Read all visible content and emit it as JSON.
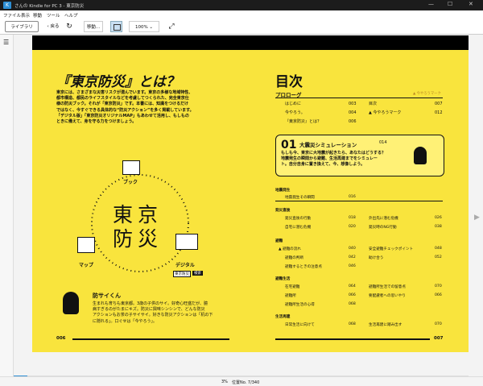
{
  "window": {
    "title": "さんの Kindle for PC 3 - 東京防災"
  },
  "menu": [
    "ファイル",
    "表示",
    "移動",
    "ツール",
    "ヘルプ"
  ],
  "toolbar": {
    "library": "ライブラリ",
    "back": "戻る",
    "goto": "移動...",
    "zoom": "100%"
  },
  "status": {
    "progress": "3%",
    "location": "位置No. 7/340"
  },
  "left": {
    "title": "『東京防災』とは？",
    "intro": [
      "東京には、さまざまな災害リスクが潜んでいます。東京の多様な地域特性、",
      "都市構造、都民のライフスタイルなどを考慮してつくられた、完全東京仕",
      "様の防災ブック。それが「東京防災」です。本書には、知識をつけるだけ",
      "ではなく、今すぐできる具体的な“防災アクション”を多く掲載しています。",
      "「デジタル版」「東京防災オリジナルMAP」もあわせて活用し、もしもの",
      "ときに備えて、身を守る力をつけましょう。"
    ],
    "center1": "東京",
    "center2": "防災",
    "book_label": "ブック",
    "map_label": "マップ",
    "digital_label": "デジタル",
    "tag1": "東京防災",
    "tag2": "検索",
    "mascot_title": "防サイくん",
    "mascot_text": [
      "生まれも育ちも東京都。3歳の子供のサイ。好奇心旺盛だが、臆",
      "病すぎるのがたまにキズ。防災に興味シンシンで、どんな防災",
      "アクションもお茶の子サイサイ。好きな防災アクションは「机の下",
      "に隠れる」。口ぐせは「今やろう」。"
    ],
    "page_no": "006"
  },
  "right": {
    "title": "目次",
    "prologue": "プロローグ",
    "mark_legend": "▲ 今やろうマーク",
    "prologue_items": [
      [
        "はじめに",
        "003"
      ],
      [
        "今やろう。",
        "004"
      ],
      [
        "『東京防災』とは？",
        "006"
      ],
      [
        "目次",
        "007"
      ],
      [
        "▲ 今やろうマーク",
        "012"
      ]
    ],
    "ch_no": "01",
    "ch_title": "大震災シミュレーション",
    "ch_page": "014",
    "ch_text": [
      "もしも今、東京に大地震が起きたら、あなたはどうする？",
      "地震発生の瞬間から避難、生活再建までをシミュレー",
      "ト。自分自身に置き換えて、今、想像しよう。"
    ],
    "s1": "地震発生",
    "s1_items": [
      [
        "地震発生その瞬間",
        "016"
      ]
    ],
    "s2": "発災直後",
    "s2_items": [
      [
        "発災直後の行動",
        "018"
      ],
      [
        "自宅に潜む危機",
        "020"
      ],
      [
        "外出先に潜む危機",
        "026"
      ],
      [
        "発災時のNG行動",
        "038"
      ]
    ],
    "s3": "避難",
    "s3_items": [
      [
        "▲ 避難の流れ",
        "040"
      ],
      [
        "避難の判断",
        "042"
      ],
      [
        "避難するときの注意点",
        "046"
      ],
      [
        "安全避難チェックポイント",
        "048"
      ],
      [
        "助け合う",
        "052"
      ]
    ],
    "s4": "避難生活",
    "s4_items": [
      [
        "在宅避難",
        "064"
      ],
      [
        "避難所",
        "066"
      ],
      [
        "避難所生活の心得",
        "068"
      ],
      [
        "避難所生活での留意点",
        "070"
      ],
      [
        "要配慮者への思いやり",
        "066"
      ]
    ],
    "s5": "生活再建",
    "s5_items": [
      [
        "日常生活に向けて",
        "068"
      ],
      [
        "生活再建に踏み出す",
        "070"
      ]
    ],
    "page_no": "007"
  }
}
